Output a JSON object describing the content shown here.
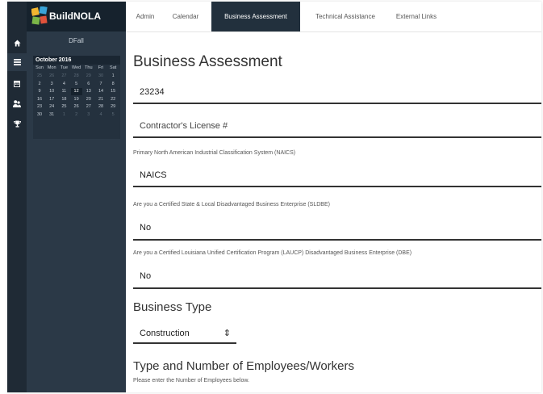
{
  "brand": {
    "name": "BuildNOLA"
  },
  "sidebar": {
    "filter_label": "DFall",
    "calendar": {
      "month_label": "October 2016",
      "weekdays": [
        "Sun",
        "Mon",
        "Tue",
        "Wed",
        "Thu",
        "Fri",
        "Sat"
      ],
      "weeks": [
        [
          "25",
          "26",
          "27",
          "28",
          "29",
          "30",
          "1"
        ],
        [
          "2",
          "3",
          "4",
          "5",
          "6",
          "7",
          "8"
        ],
        [
          "9",
          "10",
          "11",
          "12",
          "13",
          "14",
          "15"
        ],
        [
          "16",
          "17",
          "18",
          "19",
          "20",
          "21",
          "22"
        ],
        [
          "23",
          "24",
          "25",
          "26",
          "27",
          "28",
          "29"
        ],
        [
          "30",
          "31",
          "1",
          "2",
          "3",
          "4",
          "5"
        ]
      ],
      "selected_day": "12"
    },
    "icons": [
      "home-icon",
      "list-icon",
      "calendar-icon",
      "users-icon",
      "trophy-icon"
    ]
  },
  "nav": {
    "tabs": [
      {
        "label": "Admin"
      },
      {
        "label": "Calendar"
      },
      {
        "label": "Business Assessment",
        "active": true
      },
      {
        "label": "Technical Assistance"
      },
      {
        "label": "External Links"
      }
    ]
  },
  "form": {
    "title": "Business Assessment",
    "id_value": "23234",
    "license_placeholder": "Contractor's License #",
    "naics_label": "Primary North American Industrial Classification System (NAICS)",
    "naics_value": "NAICS",
    "sldbe_label": "Are you a Certified State & Local Disadvantaged Business Enterprise (SLDBE)",
    "sldbe_value": "No",
    "dbe_label": "Are you a Certified Louisiana Unified Certification Program (LAUCP) Disadvantaged Business Enterprise (DBE)",
    "dbe_value": "No",
    "business_type_heading": "Business Type",
    "business_type_value": "Construction",
    "employees_heading": "Type and Number of Employees/Workers",
    "employees_hint": "Please enter the Number of Employees below."
  },
  "colors": {
    "rail": "#1f2a35",
    "sidebar": "#2b3947",
    "brand_bar": "#16222d",
    "active_tab": "#22303d"
  }
}
